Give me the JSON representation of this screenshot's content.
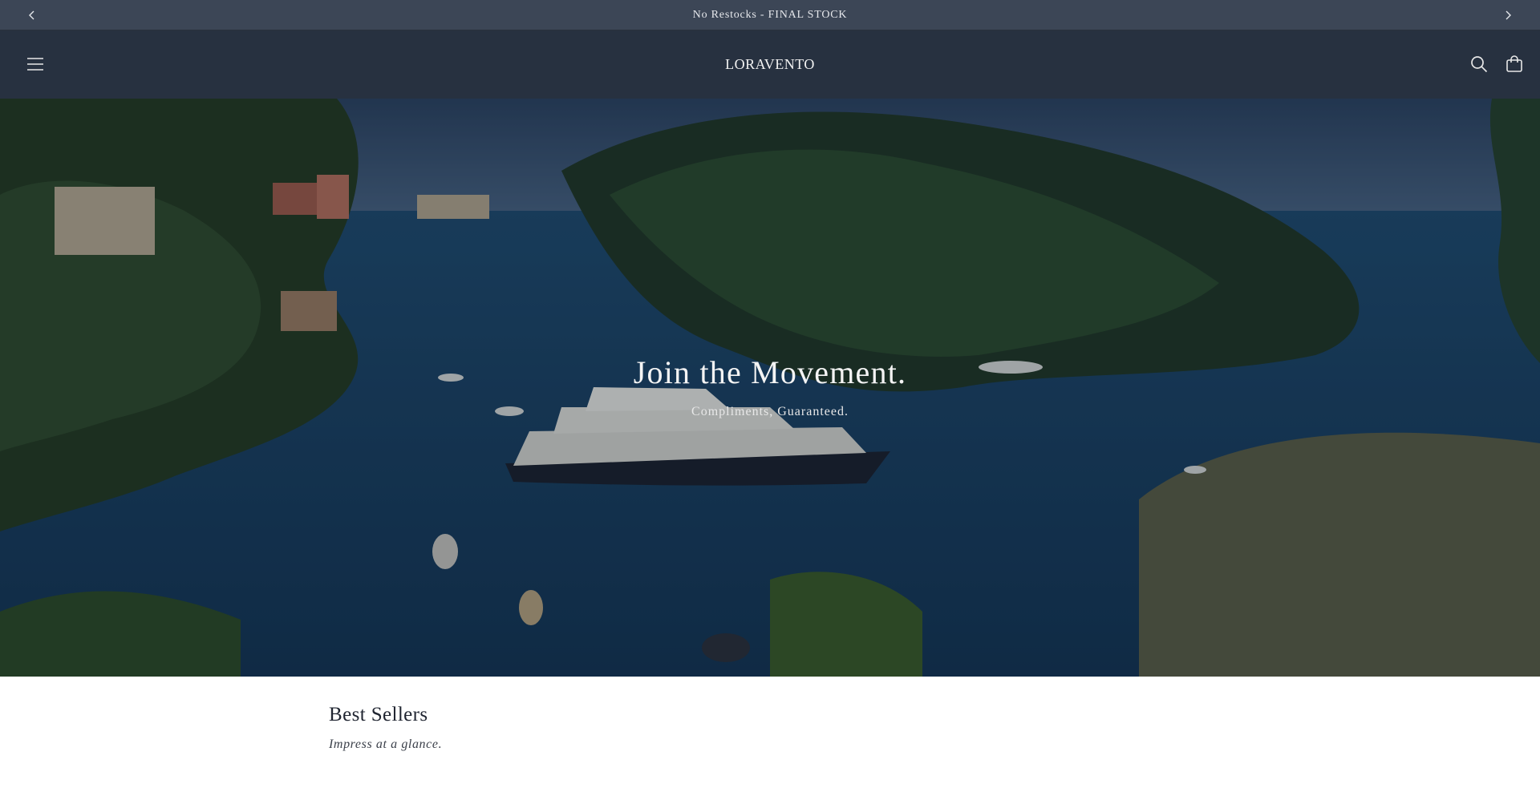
{
  "announcement": {
    "text": "No Restocks - FINAL STOCK",
    "prev_icon": "chevron-left-icon",
    "next_icon": "chevron-right-icon"
  },
  "header": {
    "logo": "LORAVENTO",
    "menu_icon": "hamburger-menu-icon",
    "search_icon": "search-icon",
    "cart_icon": "cart-icon"
  },
  "hero": {
    "heading": "Join the Movement.",
    "subheading": "Compliments, Guaranteed."
  },
  "bestsellers": {
    "title": "Best Sellers",
    "subtitle": "Impress at a glance."
  },
  "colors": {
    "announcement_bg": "#3c4656",
    "header_bg": "#273140",
    "hero_water": "#1c3a55"
  }
}
